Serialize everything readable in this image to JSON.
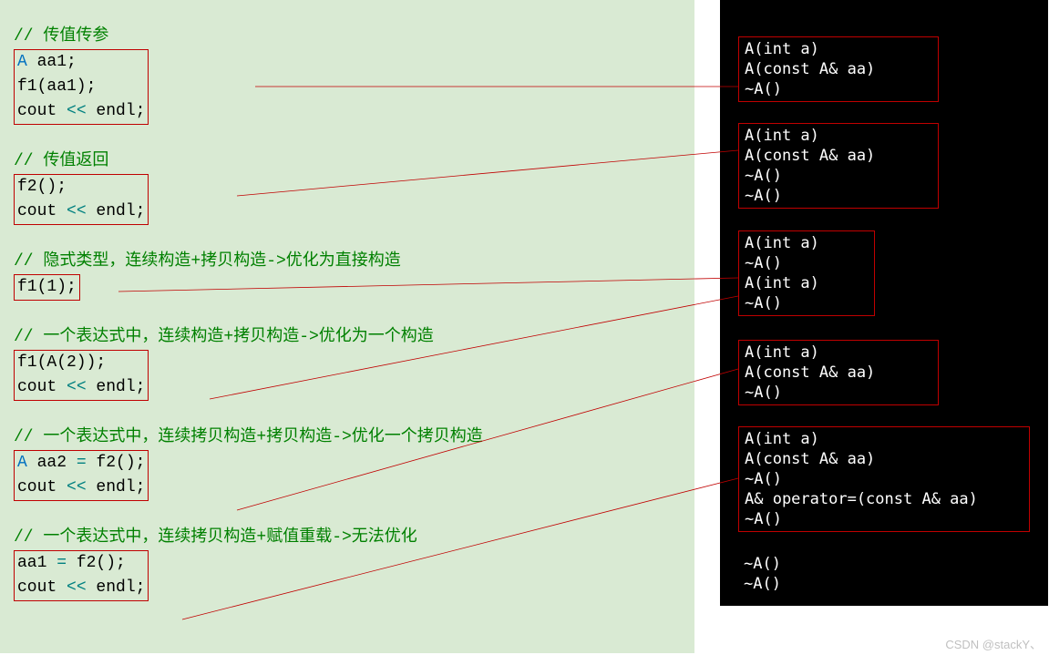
{
  "code": {
    "l0": "// 传值传参",
    "l1a": "A",
    "l1b": " aa1;",
    "l2": "f1(aa1);",
    "l3a": "cout ",
    "l3b": "<<",
    "l3c": " endl;",
    "l5": "// 传值返回",
    "l6": "f2();",
    "l7a": "cout ",
    "l7b": "<<",
    "l7c": " endl;",
    "l9": "// 隐式类型，连续构造+拷贝构造->优化为直接构造",
    "l10": "f1(1);",
    "l12": "// 一个表达式中，连续构造+拷贝构造->优化为一个构造",
    "l13": "f1(A(2));",
    "l14a": "cout ",
    "l14b": "<<",
    "l14c": " endl;",
    "l16": "// 一个表达式中，连续拷贝构造+拷贝构造->优化一个拷贝构造",
    "l17a": "A",
    "l17b": " aa2 ",
    "l17c": "=",
    "l17d": " f2();",
    "l18a": "cout ",
    "l18b": "<<",
    "l18c": " endl;",
    "l20": "// 一个表达式中，连续拷贝构造+赋值重载->无法优化",
    "l21a": "aa1 ",
    "l21b": "=",
    "l21c": " f2();",
    "l22a": "cout ",
    "l22b": "<<",
    "l22c": " endl;"
  },
  "console": {
    "b1": "A(int a)\nA(const A& aa)\n~A()",
    "b2": "A(int a)\nA(const A& aa)\n~A()\n~A()",
    "b3": "A(int a)\n~A()\nA(int a)\n~A()",
    "b4": "A(int a)\nA(const A& aa)\n~A()",
    "b5": "A(int a)\nA(const A& aa)\n~A()\nA& operator=(const A& aa)\n~A()",
    "b6": "~A()\n~A()"
  },
  "watermark": "CSDN @stackY、"
}
